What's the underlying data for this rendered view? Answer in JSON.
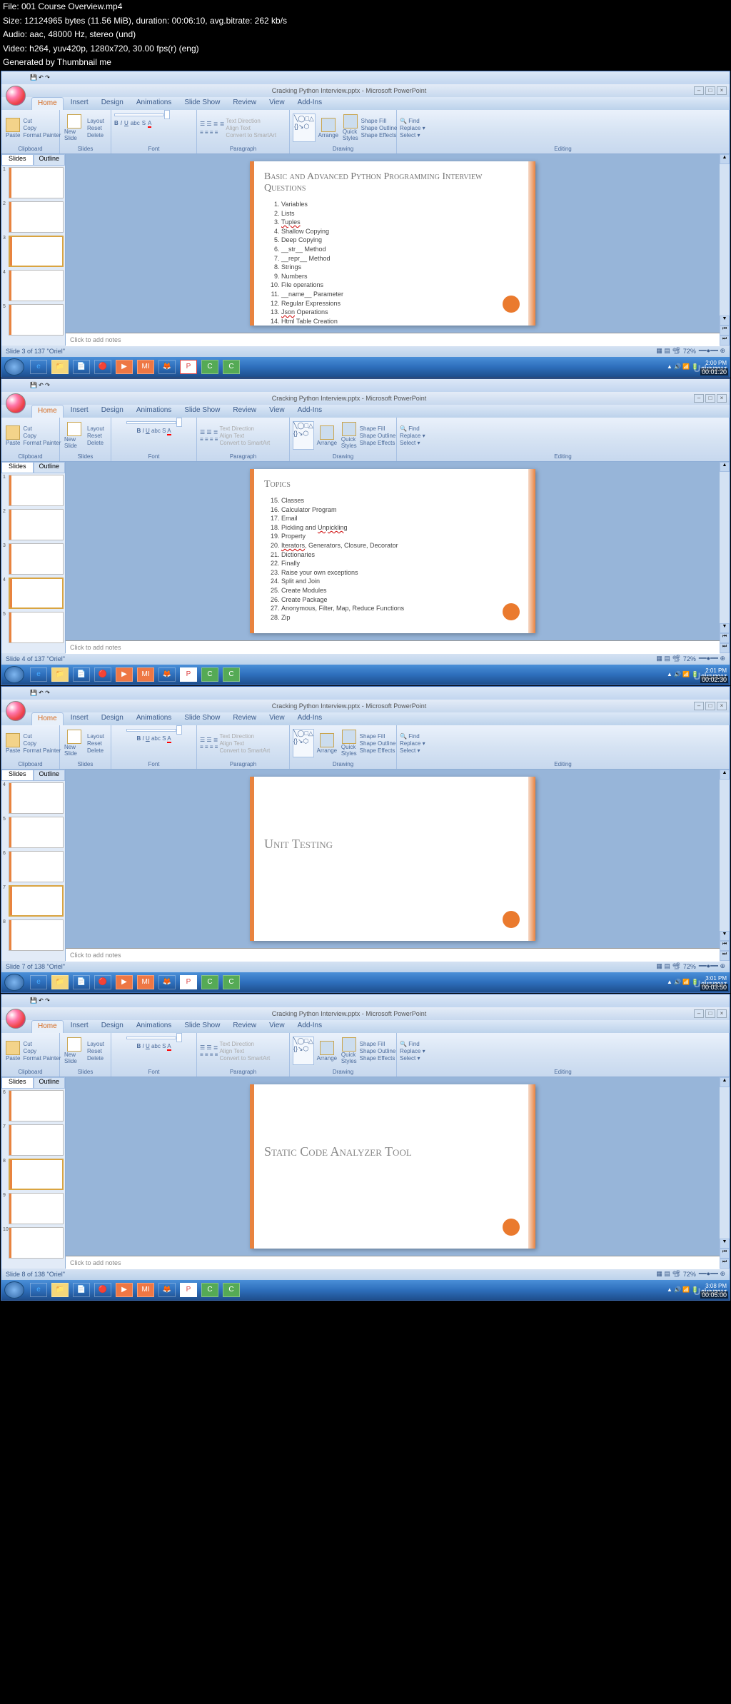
{
  "fileinfo": {
    "l1": "File: 001 Course Overview.mp4",
    "l2": "Size: 12124965 bytes (11.56 MiB), duration: 00:06:10, avg.bitrate: 262 kb/s",
    "l3": "Audio: aac, 48000 Hz, stereo (und)",
    "l4": "Video: h264, yuv420p, 1280x720, 30.00 fps(r) (eng)",
    "l5": "Generated by Thumbnail me"
  },
  "wnd": {
    "title": "Cracking Python Interview.pptx - Microsoft PowerPoint"
  },
  "tabs": {
    "home": "Home",
    "insert": "Insert",
    "design": "Design",
    "anim": "Animations",
    "slideshow": "Slide Show",
    "review": "Review",
    "view": "View",
    "addins": "Add-Ins"
  },
  "groups": {
    "clipboard": "Clipboard",
    "slides": "Slides",
    "font": "Font",
    "paragraph": "Paragraph",
    "drawing": "Drawing",
    "editing": "Editing"
  },
  "clip": {
    "paste": "Paste",
    "cut": "Cut",
    "copy": "Copy",
    "format": "Format Painter"
  },
  "slides_grp": {
    "new": "New Slide",
    "layout": "Layout",
    "reset": "Reset",
    "delete": "Delete"
  },
  "para": {
    "dir": "Text Direction",
    "align": "Align Text",
    "smart": "Convert to SmartArt"
  },
  "draw": {
    "arrange": "Arrange",
    "quick": "Quick Styles",
    "fill": "Shape Fill",
    "outline": "Shape Outline",
    "effects": "Shape Effects"
  },
  "edit": {
    "find": "Find",
    "replace": "Replace",
    "select": "Select"
  },
  "sidepane": {
    "slides": "Slides",
    "outline": "Outline"
  },
  "notes": "Click to add notes",
  "panel1": {
    "title": "Basic and Advanced Python Programming Interview Questions",
    "items": [
      "Variables",
      "Lists",
      "Tuples",
      "Shallow Copying",
      "Deep Copying",
      "__str__ Method",
      "__repr__ Method",
      "Strings",
      "Numbers",
      "File operations",
      "__name__ Parameter",
      "Regular Expressions",
      "Json Operations",
      "Html Table Creation"
    ],
    "status": "Slide 3 of 137   \"Oriel\"",
    "zoom": "72%",
    "time": "2:00 PM",
    "date": "3/15/2017",
    "ts": "00:01:20"
  },
  "panel2": {
    "title": "Topics",
    "items": [
      "Classes",
      "Calculator Program",
      "Email",
      "Pickling and Unpickling",
      "Property",
      "Iterators, Generators, Closure, Decorator",
      "Dictionaries",
      "Finally",
      "Raise your own exceptions",
      "Split and Join",
      "Create Modules",
      "Create Package",
      "Anonymous, Filter, Map, Reduce Functions",
      "Zip"
    ],
    "start": 15,
    "status": "Slide 4 of 137   \"Oriel\"",
    "zoom": "72%",
    "time": "2:01 PM",
    "date": "3/15/2017",
    "ts": "00:02:30"
  },
  "panel3": {
    "title": "Unit Testing",
    "status": "Slide 7 of 138   \"Oriel\"",
    "zoom": "72%",
    "time": "3:01 PM",
    "date": "3/15/2017",
    "ts": "00:03:50"
  },
  "panel4": {
    "title": "Static Code Analyzer Tool",
    "status": "Slide 8 of 138   \"Oriel\"",
    "zoom": "72%",
    "time": "3:08 PM",
    "date": "3/15/2017",
    "ts": "00:05:00"
  },
  "watermark": "Udemy"
}
